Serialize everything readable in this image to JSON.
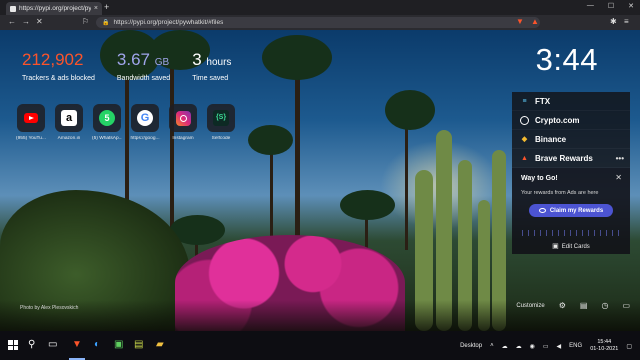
{
  "browser": {
    "tab_title": "https://pypi.org/project/pywhat...",
    "new_tab_symbol": "+",
    "url": "https://pypi.org/project/pywhatkit/#files"
  },
  "stats": [
    {
      "value": "212,902",
      "unit": "",
      "label": "Trackers & ads blocked"
    },
    {
      "value": "3.67",
      "unit": "GB",
      "label": "Bandwidth saved"
    },
    {
      "value": "3",
      "unit": "hours",
      "label": "Time saved"
    }
  ],
  "clock": "3:44",
  "top_sites": [
    {
      "label": "(955) YouTu...",
      "icon": "youtube-icon"
    },
    {
      "label": "Amazon.in",
      "icon": "amazon-icon"
    },
    {
      "label": "(5) WhatsAp...",
      "icon": "whatsapp-icon"
    },
    {
      "label": "https://goog...",
      "icon": "google-icon"
    },
    {
      "label": "Instagram",
      "icon": "instagram-icon"
    },
    {
      "label": "Selfcode",
      "icon": "selfcode-icon"
    }
  ],
  "widgets": {
    "items": [
      {
        "label": "FTX",
        "icon": "ftx-icon"
      },
      {
        "label": "Crypto.com",
        "icon": "crypto-com-icon"
      },
      {
        "label": "Binance",
        "icon": "binance-icon"
      },
      {
        "label": "Brave Rewards",
        "icon": "brave-rewards-icon"
      }
    ],
    "rewards": {
      "heading": "Way to Go!",
      "message": "Your rewards from Ads are here",
      "claim_label": "Claim my Rewards",
      "edit_cards_label": "Edit Cards"
    }
  },
  "photo_credit": "Photo by Alex Plesovskich",
  "customize_label": "Customize",
  "taskbar": {
    "desktop_label": "Desktop",
    "language": "ENG",
    "time": "15:44",
    "date": "01-10-2021"
  },
  "colors": {
    "trackers": "#fb542b",
    "bandwidth": "#a0a5eb",
    "claim_button": "#4c54d2"
  }
}
